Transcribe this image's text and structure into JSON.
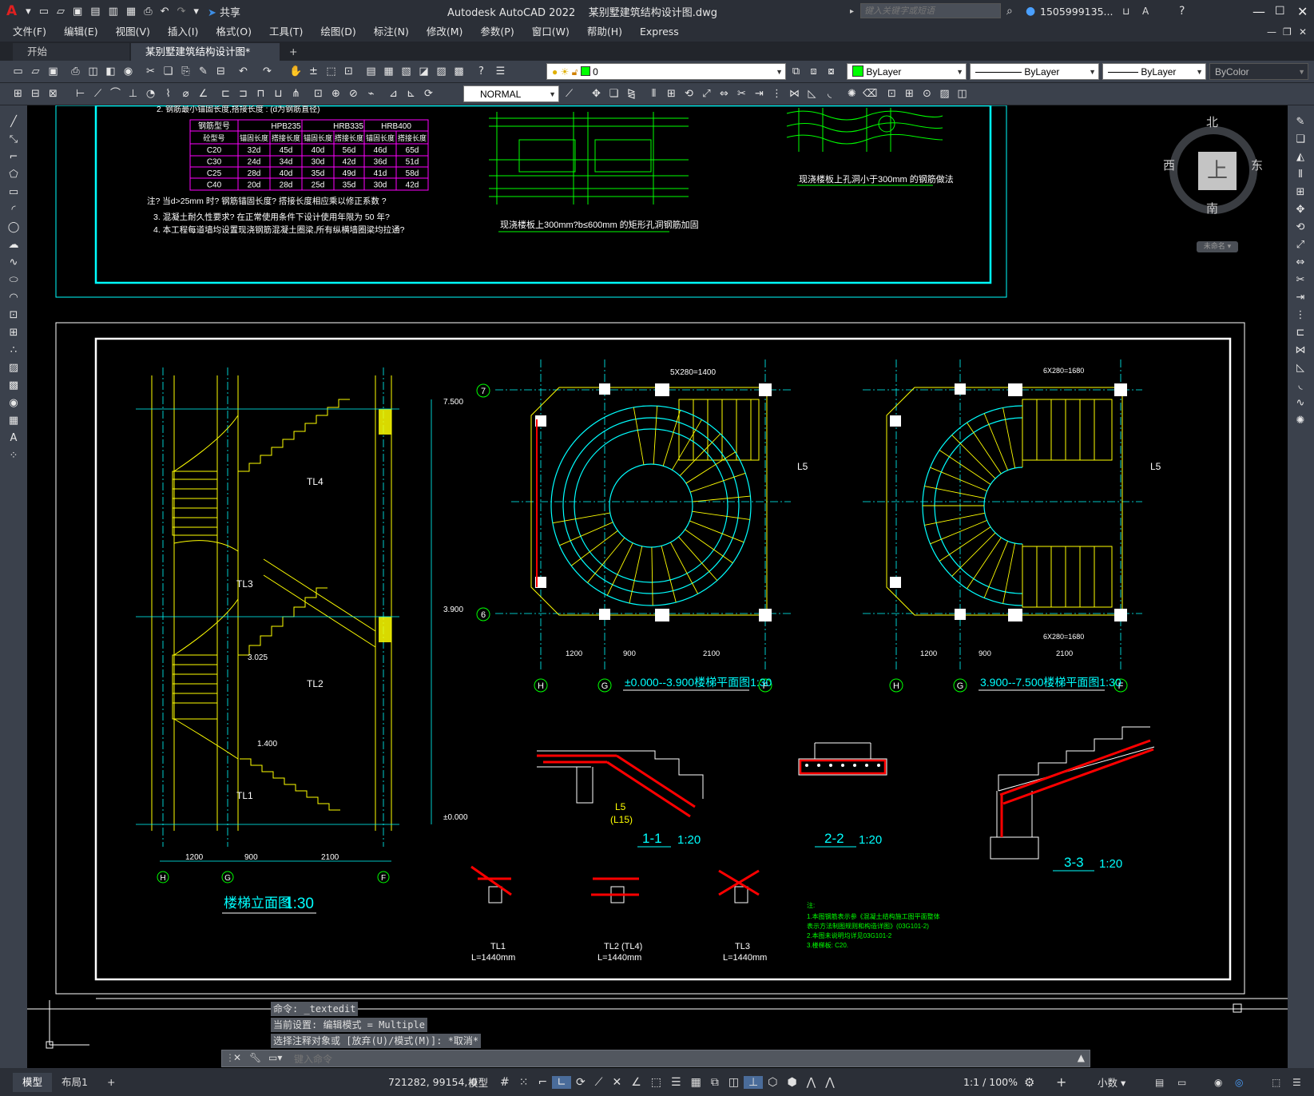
{
  "window": {
    "app_title": "Autodesk AutoCAD 2022",
    "file_title": "某别墅建筑结构设计图.dwg",
    "share_label": "共享",
    "search_placeholder": "键入关键字或短语",
    "user": "1505999135..."
  },
  "menu": [
    "文件(F)",
    "编辑(E)",
    "视图(V)",
    "插入(I)",
    "格式(O)",
    "工具(T)",
    "绘图(D)",
    "标注(N)",
    "修改(M)",
    "参数(P)",
    "窗口(W)",
    "帮助(H)",
    "Express"
  ],
  "tabs": [
    {
      "label": "开始"
    },
    {
      "label": "某别墅建筑结构设计图*"
    }
  ],
  "toolbar": {
    "layer_value": "0",
    "color_value": "ByLayer",
    "linetype_value": "ByLayer",
    "lineweight_value": "ByLayer",
    "plotstyle_value": "ByColor",
    "textstyle_value": "NORMAL"
  },
  "viewcube": {
    "north": "北",
    "south": "南",
    "east": "东",
    "west": "西",
    "top": "上",
    "wcs": "未命名"
  },
  "drawing": {
    "table_title": "2. 钢筋最小锚固长度,搭接长度 : (d为钢筋直径)",
    "table_header": [
      "钢筋型号",
      "HPB235",
      "HRB335",
      "HRB400"
    ],
    "table_subheader": [
      "砼型号",
      "锚固长度",
      "搭接长度",
      "锚固长度",
      "搭接长度",
      "锚固长度",
      "搭接长度"
    ],
    "table_rows": [
      [
        "C20",
        "32d",
        "45d",
        "40d",
        "56d",
        "46d",
        "65d"
      ],
      [
        "C30",
        "24d",
        "34d",
        "30d",
        "42d",
        "36d",
        "51d"
      ],
      [
        "C25",
        "28d",
        "40d",
        "35d",
        "49d",
        "41d",
        "58d"
      ],
      [
        "C40",
        "20d",
        "28d",
        "25d",
        "35d",
        "30d",
        "42d"
      ]
    ],
    "notes": [
      "注? 当d>25mm      时? 钢筋锚固长度? 搭接长度相应乘以修正系数          ?",
      "3.  混凝土耐久性要求? 在正常使用条件下设计使用年限为 50 年?",
      "4.  本工程每道墙均设置现浇钢筋混凝土圈梁,所有纵横墙圈梁均拉通?"
    ],
    "detail_caption_1": "现浇楼板上300mm?b≤600mm 的矩形孔洞钢筋加固",
    "detail_caption_2": "现浇楼板上孔洞小于300mm 的钢筋做法",
    "elevation_title": "楼梯立面图",
    "elevation_scale": "1:30",
    "plan1_title": "±0.000--3.900楼梯平面图1:30",
    "plan2_title": "3.900--7.500楼梯平面图1:30",
    "section_11": "1-1",
    "section_22": "2-2",
    "section_33": "3-3",
    "section_scale": "1:20",
    "levels": [
      "7.500",
      "3.900",
      "3.025",
      "1.400",
      "±0.000"
    ],
    "beam_labels": [
      "TL4",
      "TL3",
      "TL2",
      "TL1",
      "L5",
      "(L15)"
    ],
    "axis_labels": [
      "H",
      "G",
      "F",
      "7",
      "6"
    ],
    "dims_bottom": [
      "1200",
      "900",
      "2100"
    ],
    "plan_dim_top": "5X280=1400",
    "plan2_dim_top": "6X280=1680",
    "plan2_dim_bot": "6X280=1680",
    "beam_detail_labels": [
      "TL1",
      "TL2 (TL4)",
      "TL3"
    ],
    "beam_length": "L=1440mm",
    "green_notes": [
      "注:",
      "1.本图钢筋表示参《混凝土结构施工图平面整体",
      "  表示方法制图规则和构造详图》(03G101-2)",
      "2.本图未说明均详见03G101-2",
      "3.楼梯板: C20."
    ]
  },
  "command": {
    "history": [
      "命令: _textedit",
      "当前设置: 编辑模式 = Multiple",
      "选择注释对象或 [放弃(U)/模式(M)]: *取消*"
    ],
    "placeholder": "键入命令"
  },
  "status": {
    "tabs": [
      "模型",
      "布局1"
    ],
    "coords": "721282, 99154, 0",
    "model_label": "模型",
    "scale": "1:1 / 100%",
    "units": "小数"
  },
  "colors": {
    "cyan": "#00ffff",
    "yellow": "#ffff00",
    "green": "#00ff00",
    "magenta": "#ff00ff",
    "red": "#ff0000",
    "white": "#ffffff"
  }
}
